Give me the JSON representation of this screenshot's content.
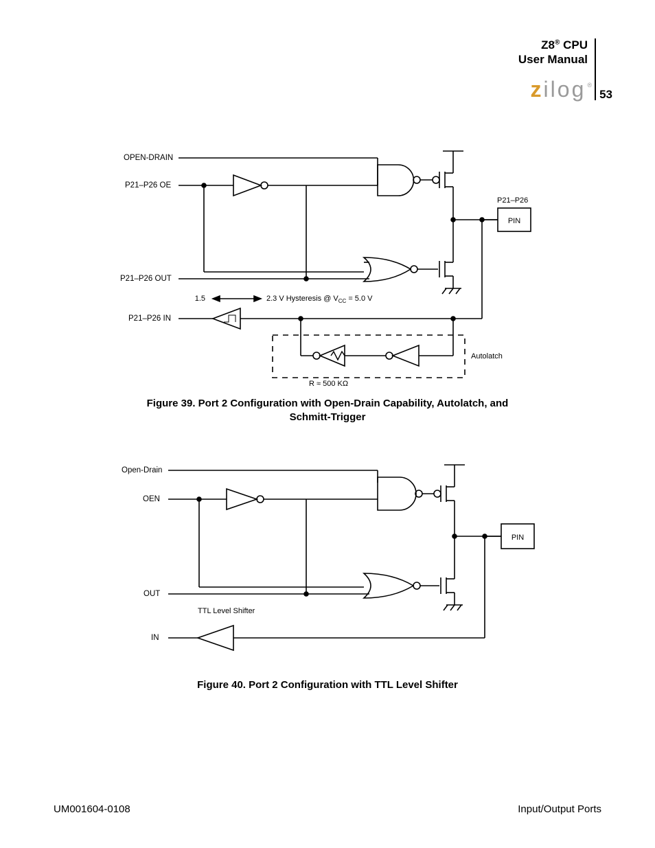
{
  "header": {
    "title_line1_prefix": "Z8",
    "title_line1_sup": "®",
    "title_line1_suffix": " CPU",
    "title_line2": "User Manual"
  },
  "logo": {
    "z": "z",
    "rest": "ilog",
    "reg": "®"
  },
  "page_number": "53",
  "figure39": {
    "caption_line1": "Figure 39. Port 2 Configuration with Open-Drain Capability, Autolatch, and",
    "caption_line2": "Schmitt-Trigger",
    "labels": {
      "open_drain": "OPEN-DRAIN",
      "oe": "P21–P26 OE",
      "out": "P21–P26 OUT",
      "in_label": "P21–P26 IN",
      "hysteresis": "2.3 V Hysteresis @ V",
      "hysteresis_sub": "CC",
      "hysteresis_tail": " = 5.0 V",
      "hyst_low": "1.5",
      "pin_group": "P21–P26",
      "pin": "PIN",
      "autolatch": "Autolatch",
      "rvalue_prefix": "R ",
      "rvalue_approx": "≈",
      "rvalue_suffix": " 500 KΩ"
    }
  },
  "figure40": {
    "caption": "Figure 40. Port 2 Configuration with TTL Level Shifter",
    "labels": {
      "open_drain": "Open-Drain",
      "oen": "OEN",
      "out": "OUT",
      "in_label": "IN",
      "ttl": "TTL Level Shifter",
      "pin": "PIN"
    }
  },
  "footer": {
    "left": "UM001604-0108",
    "right": "Input/Output Ports"
  }
}
